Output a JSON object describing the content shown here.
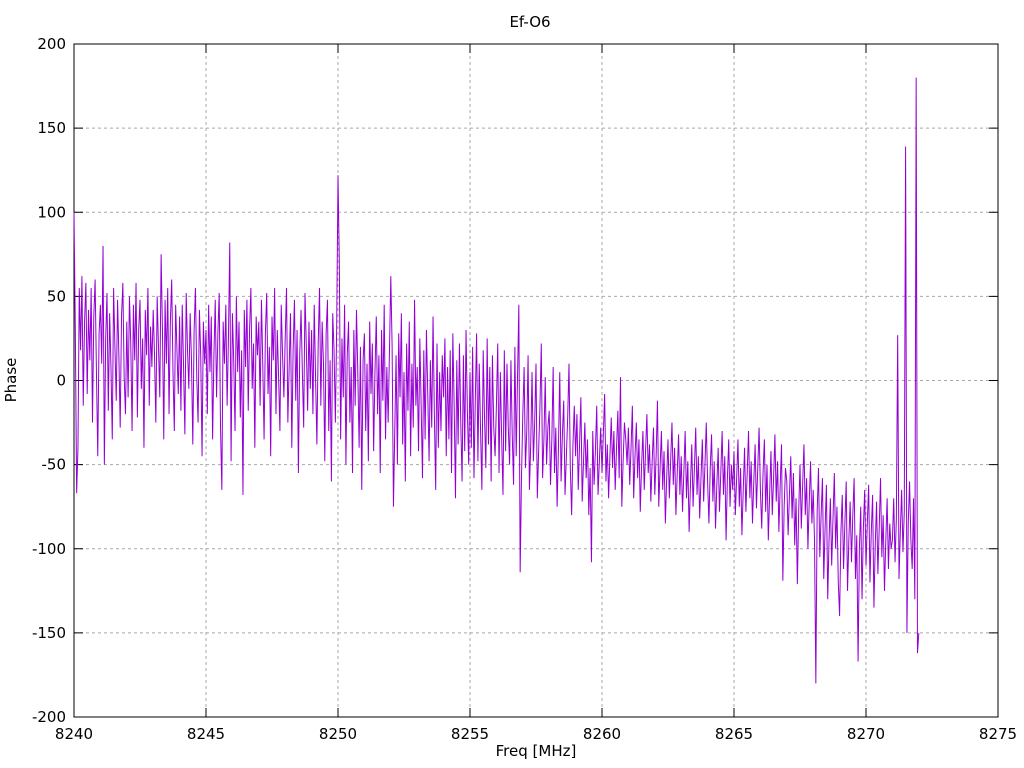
{
  "chart_data": {
    "type": "line",
    "title": "Ef-O6",
    "xlabel": "Freq [MHz]",
    "ylabel": "Phase",
    "xlim": [
      8240,
      8275
    ],
    "ylim": [
      -200,
      200
    ],
    "xticks": [
      8240,
      8245,
      8250,
      8255,
      8260,
      8265,
      8270,
      8275
    ],
    "yticks": [
      -200,
      -150,
      -100,
      -50,
      0,
      50,
      100,
      150,
      200
    ],
    "grid": true,
    "legend_position": "none",
    "line_color": "#9400d3",
    "grid_color": "#a9a9a9",
    "border_color": "#000000",
    "series": [
      {
        "name": "Phase",
        "x_start": 8240,
        "x_step": 0.05,
        "y": [
          100,
          30,
          -67,
          -40,
          55,
          18,
          62,
          -15,
          35,
          58,
          -8,
          42,
          12,
          55,
          -25,
          38,
          60,
          5,
          -45,
          28,
          45,
          10,
          80,
          -50,
          25,
          52,
          -18,
          40,
          8,
          -35,
          55,
          20,
          -12,
          48,
          15,
          -28,
          38,
          58,
          2,
          -20,
          35,
          -10,
          50,
          22,
          -30,
          45,
          12,
          58,
          -22,
          30,
          48,
          -5,
          25,
          -40,
          42,
          15,
          55,
          -15,
          32,
          8,
          42,
          15,
          -25,
          50,
          20,
          -10,
          75,
          30,
          -35,
          48,
          10,
          55,
          -20,
          35,
          60,
          5,
          -30,
          45,
          18,
          -8,
          38,
          -18,
          45,
          8,
          -32,
          52,
          18,
          -5,
          40,
          12,
          -38,
          30,
          55,
          2,
          -25,
          42,
          15,
          -45,
          35,
          10,
          30,
          -20,
          45,
          5,
          38,
          -35,
          15,
          48,
          -10,
          28,
          52,
          -28,
          -65,
          35,
          10,
          45,
          -15,
          25,
          82,
          -48,
          40,
          12,
          -30,
          50,
          5,
          35,
          -22,
          18,
          -68,
          42,
          8,
          48,
          -18,
          30,
          55,
          -5,
          22,
          -40,
          38,
          15,
          35,
          -15,
          48,
          10,
          -35,
          28,
          52,
          -8,
          20,
          -45,
          38,
          12,
          55,
          -20,
          30,
          2,
          -30,
          45,
          15,
          -10,
          25,
          55,
          -25,
          8,
          40,
          -40,
          18,
          48,
          -12,
          30,
          -55,
          15,
          42,
          5,
          -28,
          52,
          20,
          -18,
          35,
          -5,
          30,
          -20,
          45,
          2,
          -38,
          22,
          55,
          -15,
          35,
          10,
          -48,
          28,
          48,
          -30,
          12,
          -60,
          40,
          18,
          -25,
          32,
          122,
          70,
          -35,
          25,
          -10,
          45,
          -50,
          15,
          35,
          -25,
          8,
          -55,
          30,
          -15,
          42,
          5,
          -40,
          20,
          -65,
          12,
          28,
          -30,
          10,
          -48,
          35,
          -8,
          22,
          -42,
          5,
          38,
          -20,
          15,
          -55,
          30,
          -12,
          45,
          -35,
          8,
          -25,
          18,
          62,
          20,
          -75,
          -30,
          15,
          -50,
          28,
          -10,
          40,
          -38,
          5,
          -60,
          22,
          -18,
          35,
          -45,
          10,
          -28,
          48,
          -15,
          8,
          -42,
          25,
          -15,
          -58,
          18,
          -35,
          30,
          -8,
          -48,
          12,
          -28,
          38,
          -20,
          -65,
          22,
          -40,
          5,
          -30,
          15,
          -10,
          25,
          -45,
          8,
          -35,
          18,
          -55,
          28,
          -15,
          -70,
          12,
          -38,
          22,
          -25,
          -60,
          15,
          -42,
          30,
          -18,
          -50,
          5,
          -40,
          20,
          -58,
          -12,
          28,
          -48,
          10,
          -30,
          -65,
          18,
          -22,
          -52,
          25,
          -38,
          8,
          -60,
          15,
          -28,
          -45,
          -15,
          22,
          -55,
          5,
          -35,
          -68,
          18,
          -42,
          10,
          -28,
          -50,
          12,
          -32,
          -62,
          20,
          -45,
          2,
          45,
          -114,
          -58,
          -20,
          8,
          -52,
          -30,
          15,
          -65,
          -38,
          5,
          -48,
          -25,
          10,
          -70,
          -42,
          -15,
          22,
          -58,
          -35,
          2,
          -50,
          -28,
          -18,
          -62,
          -35,
          8,
          -55,
          -28,
          -75,
          -40,
          5,
          -60,
          -32,
          -12,
          -68,
          -45,
          -22,
          10,
          -52,
          -80,
          -38,
          -15,
          -45,
          -20,
          -65,
          -38,
          -10,
          -72,
          -48,
          -25,
          -58,
          -35,
          -80,
          -52,
          -108,
          -30,
          -62,
          -42,
          -15,
          -68,
          -48,
          -28,
          -55,
          -32,
          -8,
          -60,
          -38,
          -70,
          -45,
          -22,
          -52,
          -30,
          -65,
          -40,
          -18,
          -58,
          2,
          -75,
          -48,
          -25,
          -35,
          -50,
          -28,
          -62,
          -40,
          -15,
          -70,
          -45,
          -25,
          -58,
          -35,
          -78,
          -50,
          -30,
          -65,
          -42,
          -20,
          -55,
          -38,
          -72,
          -48,
          -28,
          -68,
          -45,
          -12,
          -75,
          -52,
          -30,
          -65,
          -42,
          -85,
          -58,
          -35,
          -70,
          -48,
          -25,
          -62,
          -40,
          -80,
          -55,
          -32,
          -68,
          -45,
          -78,
          -55,
          -30,
          -70,
          -48,
          -90,
          -62,
          -38,
          -75,
          -52,
          -28,
          -68,
          -45,
          -82,
          -58,
          -35,
          -72,
          -50,
          -25,
          -60,
          -85,
          -52,
          -32,
          -72,
          -48,
          -88,
          -62,
          -40,
          -78,
          -55,
          -30,
          -68,
          -45,
          -95,
          -58,
          -35,
          -75,
          -50,
          -65,
          -42,
          -80,
          -58,
          -35,
          -75,
          -52,
          -92,
          -65,
          -40,
          -78,
          -55,
          -30,
          -70,
          -48,
          -85,
          -60,
          -38,
          -76,
          -52,
          -28,
          -65,
          -88,
          -55,
          -35,
          -78,
          -50,
          -95,
          -68,
          -42,
          -80,
          -58,
          -32,
          -72,
          -48,
          -90,
          -62,
          -38,
          -119,
          -75,
          -52,
          -60,
          -92,
          -68,
          -45,
          -82,
          -55,
          -98,
          -70,
          -121,
          -78,
          -50,
          -88,
          -62,
          -38,
          -80,
          -58,
          -100,
          -72,
          -48,
          -85,
          -65,
          -95,
          -180,
          -78,
          -52,
          -105,
          -80,
          -58,
          -118,
          -88,
          -62,
          -130,
          -95,
          -70,
          -110,
          -82,
          -55,
          -100,
          -75,
          -120,
          -140,
          -90,
          -68,
          -112,
          -85,
          -60,
          -125,
          -95,
          -72,
          -108,
          -80,
          -58,
          -118,
          -92,
          -167,
          -100,
          -75,
          -130,
          -88,
          -65,
          -110,
          -85,
          -62,
          -120,
          -90,
          -68,
          -135,
          -98,
          -72,
          -115,
          -88,
          -58,
          -105,
          -80,
          -125,
          -95,
          -70,
          -112,
          -85,
          -100,
          -95,
          -70,
          -108,
          -82,
          27,
          -118,
          -90,
          -65,
          -102,
          -78,
          139,
          -150,
          -85,
          -60,
          -95,
          -112,
          -70,
          -130,
          180,
          -162,
          -150
        ]
      }
    ]
  }
}
